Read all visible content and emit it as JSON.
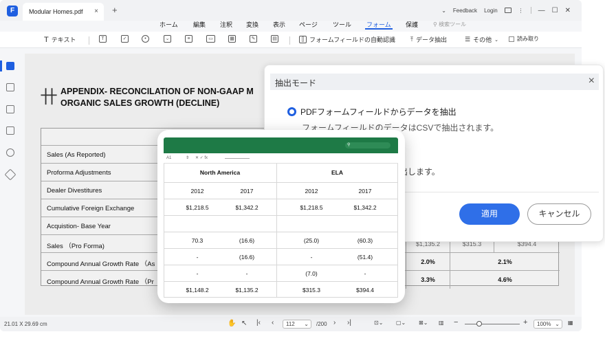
{
  "titlebar": {
    "tab_title": "Modular Homes.pdf",
    "tab_close": "×",
    "tab_add": "+",
    "feedback": "Feedback",
    "login": "Login",
    "chevron": "⌄",
    "more": "⋮"
  },
  "menu": {
    "items": [
      "ホーム",
      "編集",
      "注釈",
      "変換",
      "表示",
      "ページ",
      "ツール",
      "フォーム",
      "保護"
    ],
    "active_index": 7,
    "search_tools": "検索ツール"
  },
  "toolbar": {
    "text": "テキスト",
    "auto_recognize": "フォームフィールドの自動認識",
    "extract_data": "データ抽出",
    "more": "その他",
    "read_only": "読み取り"
  },
  "document": {
    "title_line1": "APPENDIX- RECONCILATION OF NON-GAAP M",
    "title_line2": "ORGANIC SALES GROWTH (DECLINE)",
    "rows": [
      "Sales (As Reported)",
      "Proforma Adjustments",
      "Dealer Divestitures",
      "Cumulative Foreign Exchange",
      "Acquistion- Base Year",
      "Sales （Pro Forma)",
      "Compound Annual Growth Rate （As",
      "Compound Annual Growth Rate （Pr"
    ],
    "visible_cells": {
      "r5": [
        "$1,135.2",
        "$315.3",
        "$394.4"
      ],
      "r6": [
        "2.0%",
        "2.1%"
      ],
      "r7": [
        "3.3%",
        "4.6%"
      ]
    }
  },
  "dialog": {
    "title": "抽出モード",
    "close": "×",
    "option_label": "PDFフォームフィールドからデータを抽出",
    "option_sub": "フォームフィールドのデータはCSVで抽出されます。",
    "option_sub2": "出します。",
    "apply": "適用",
    "cancel": "キャンセル"
  },
  "sheet": {
    "cell_ref": "A1",
    "headers": {
      "na": "North America",
      "ela": "ELA"
    },
    "years": [
      "2012",
      "2017",
      "2012",
      "2017"
    ],
    "rows": [
      [
        "$1,218.5",
        "$1,342.2",
        "$1,218.5",
        "$1,342.2"
      ],
      [
        "",
        "",
        "",
        ""
      ],
      [
        "70.3",
        "(16.6)",
        "(25.0)",
        "(60.3)"
      ],
      [
        "-",
        "(16.6)",
        "-",
        "(51.4)"
      ],
      [
        "-",
        "-",
        "(7.0)",
        "-"
      ],
      [
        "$1,148.2",
        "$1,135.2",
        "$315.3",
        "$394.4"
      ]
    ]
  },
  "status": {
    "dimensions": "21.01 X 29.69 cm",
    "page_current": "112",
    "page_total": "/200",
    "zoom": "100%"
  },
  "colors": {
    "accent": "#1f5fe0",
    "sheet_green": "#1e7a46"
  }
}
